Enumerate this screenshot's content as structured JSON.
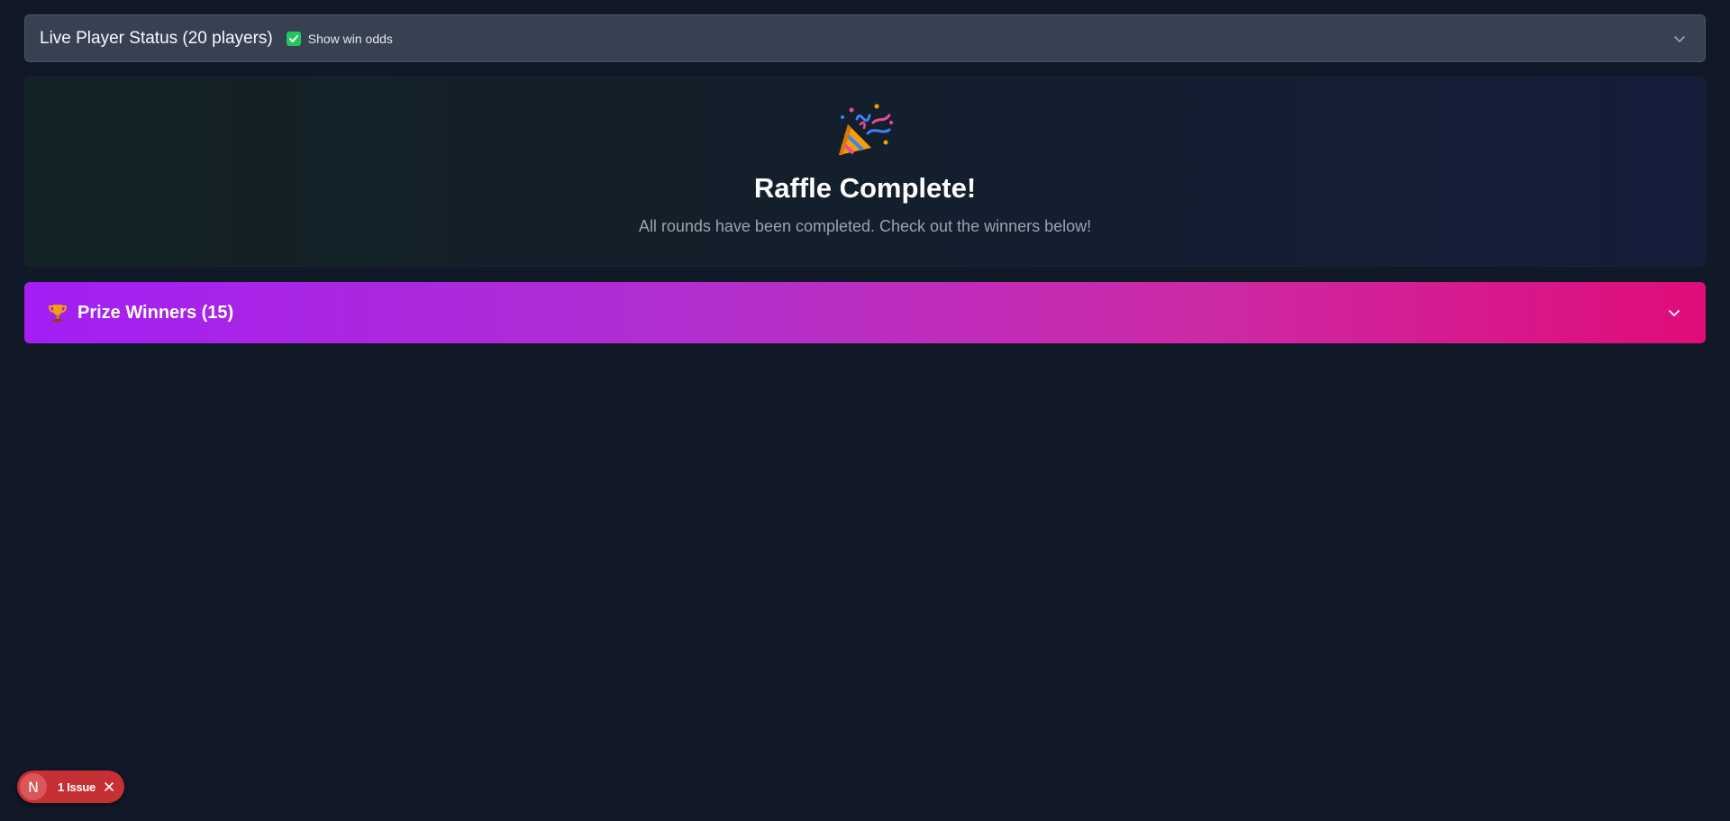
{
  "status_bar": {
    "title": "Live Player Status (20 players)",
    "checkbox_label": "Show win odds",
    "checkbox_checked": true,
    "icons": {
      "toggle": "chevron-down-icon",
      "check": "checkmark-icon"
    }
  },
  "completion": {
    "icon": "party-popper-icon",
    "title": "Raffle Complete!",
    "subtitle": "All rounds have been completed. Check out the winners below!"
  },
  "winners": {
    "icon": "trophy-icon",
    "title": "Prize Winners (15)",
    "expanded": false
  },
  "issue_badge": {
    "logo": "N",
    "text": "1 Issue",
    "close_icon": "close-icon"
  },
  "colors": {
    "background": "#111827",
    "status_bar": "#374151",
    "checkbox": "#22c55e",
    "winners_gradient_start": "#a21ff4",
    "winners_gradient_end": "#e00c79",
    "issue_badge": "#c62f34"
  }
}
